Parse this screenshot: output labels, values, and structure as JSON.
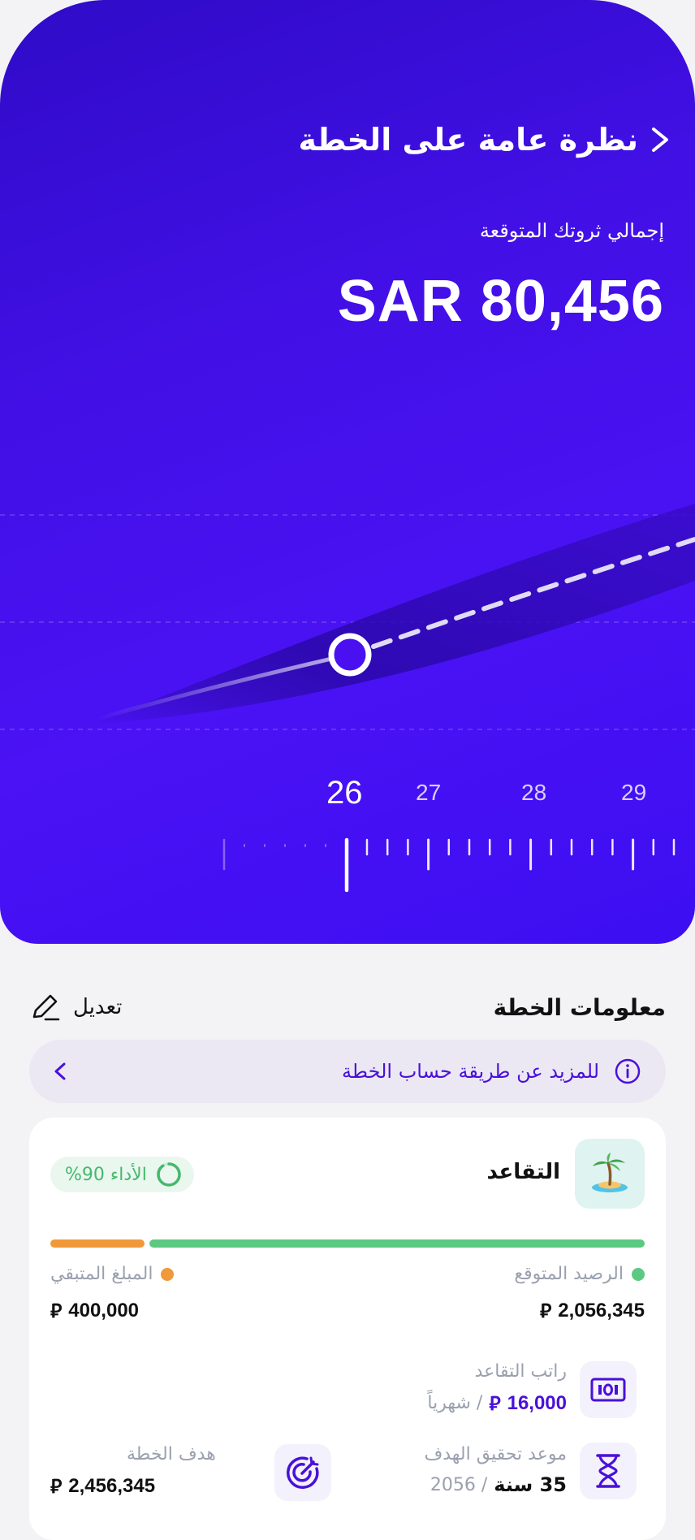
{
  "header": {
    "title": "نظرة عامة على الخطة",
    "wealth_label": "إجمالي ثروتك المتوقعة",
    "wealth_value": "SAR 80,456"
  },
  "timeline": {
    "current_year": "26",
    "years": [
      "27",
      "28",
      "29"
    ]
  },
  "plan_info": {
    "section_title": "معلومات الخطة",
    "edit_label": "تعديل",
    "info_link": "للمزيد عن طريقة حساب الخطة"
  },
  "goal_card": {
    "name": "التقاعد",
    "performance": "الأداء 90%",
    "performance_fraction": 0.9,
    "expected_balance_label": "الرصيد المتوقع",
    "expected_balance_value": "2,056,345",
    "remaining_label": "المبلغ المتبقي",
    "remaining_value": "400,000",
    "salary_label": "راتب التقاعد",
    "salary_value": "16,000",
    "salary_period": "/ شهرياً",
    "deadline_label": "موعد تحقيق الهدف",
    "deadline_value": "35 سنة",
    "deadline_year": "/ 2056",
    "target_label": "هدف الخطة",
    "target_value": "2,456,345"
  },
  "colors": {
    "primary": "#4a10f0",
    "green": "#5cc982",
    "orange": "#f0993a",
    "purple_text": "#4a10d9"
  }
}
